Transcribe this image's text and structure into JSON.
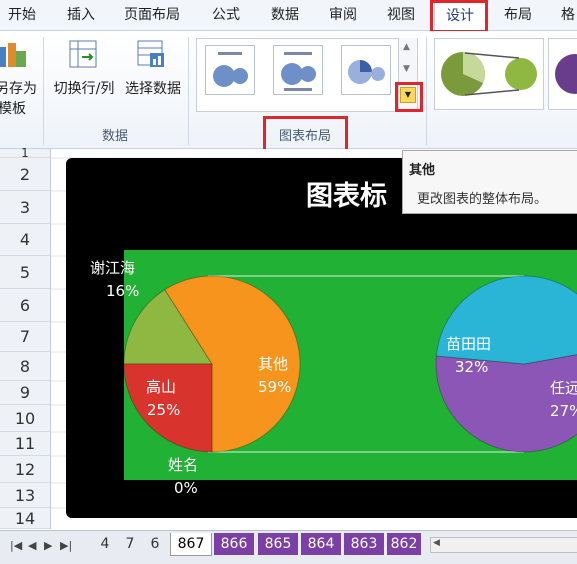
{
  "ribbon_tabs": [
    "开始",
    "插入",
    "页面布局",
    "公式",
    "数据",
    "审阅",
    "视图",
    "设计",
    "布局",
    "格"
  ],
  "ribbon": {
    "save_as_template_line1": "另存为",
    "save_as_template_line2": "模板",
    "switch_row_col": "切换行/列",
    "select_data": "选择数据",
    "data_group_label": "数据",
    "chart_layouts_group_label": "图表布局"
  },
  "tooltip": {
    "title": "其他",
    "description": "更改图表的整体布局。"
  },
  "row_numbers": [
    "1",
    "2",
    "3",
    "4",
    "5",
    "6",
    "7",
    "8",
    "9",
    "10",
    "11",
    "12",
    "13",
    "14"
  ],
  "chart": {
    "title": "图表标",
    "labels": [
      {
        "name": "谢江海",
        "pct": "16%"
      },
      {
        "name": "其他",
        "pct": "59%"
      },
      {
        "name": "高山",
        "pct": "25%"
      },
      {
        "name": "姓名",
        "pct": "0%"
      },
      {
        "name": "苗田田",
        "pct": "32%"
      },
      {
        "name": "任远",
        "pct": "27%"
      }
    ]
  },
  "chart_data": [
    {
      "type": "pie",
      "categories": [
        "谢江海",
        "其他",
        "高山",
        "姓名"
      ],
      "values": [
        16,
        59,
        25,
        0
      ],
      "colors": [
        "#8fb843",
        "#f7941d",
        "#d9332e",
        "#cccccc"
      ]
    },
    {
      "type": "pie",
      "categories": [
        "苗田田",
        "任远"
      ],
      "values": [
        32,
        27
      ],
      "colors": [
        "#8b56b5",
        "#2ab4d6"
      ]
    }
  ],
  "sheet_tabs": [
    "4",
    "7",
    "6",
    "867",
    "866",
    "865",
    "864",
    "863",
    "862"
  ],
  "active_sheet": "867",
  "colors": {
    "plot_area": "#21b135",
    "highlight_box": "#e0262b",
    "purple_tabs": "#7b3fa6"
  }
}
